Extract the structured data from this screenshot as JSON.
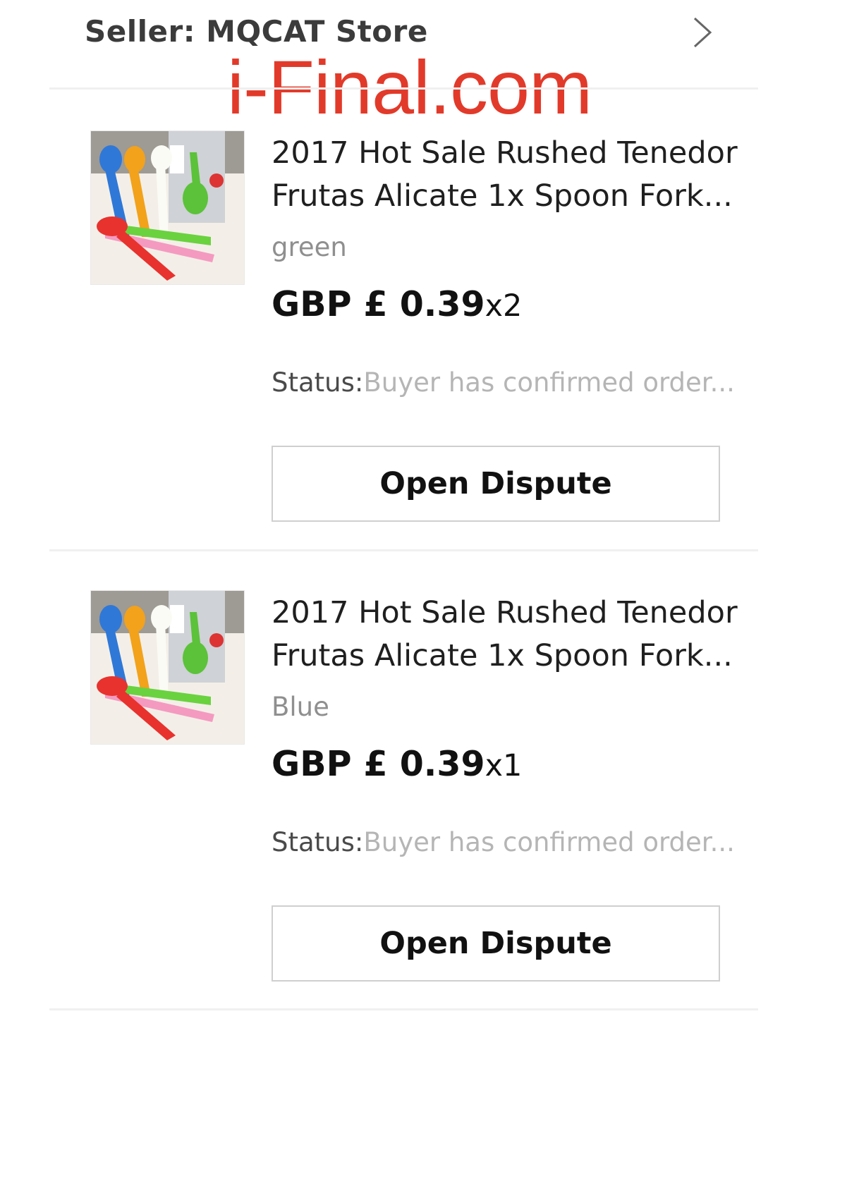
{
  "seller": {
    "label": "Seller: MQCAT Store",
    "chevron_icon": "chevron-right-icon"
  },
  "watermark": "i-Final.com",
  "items": [
    {
      "title_line1": "2017 Hot Sale Rushed Tenedor",
      "title_line2": "Frutas Alicate 1x Spoon Fork...",
      "variant": "green",
      "price": "GBP  £ 0.39",
      "quantity": "x2",
      "status_label": "Status:",
      "status_value": "Buyer has confirmed order...",
      "button_label": "Open Dispute",
      "image_icon": "product-thumbnail"
    },
    {
      "title_line1": "2017 Hot Sale Rushed Tenedor",
      "title_line2": "Frutas Alicate 1x Spoon Fork...",
      "variant": "Blue",
      "price": "GBP  £ 0.39",
      "quantity": "x1",
      "status_label": "Status:",
      "status_value": "Buyer has confirmed order...",
      "button_label": "Open Dispute",
      "image_icon": "product-thumbnail"
    }
  ],
  "colors": {
    "watermark": "#e23a2a",
    "status_value": "#b5b5b5",
    "divider": "#f0f0f0"
  }
}
